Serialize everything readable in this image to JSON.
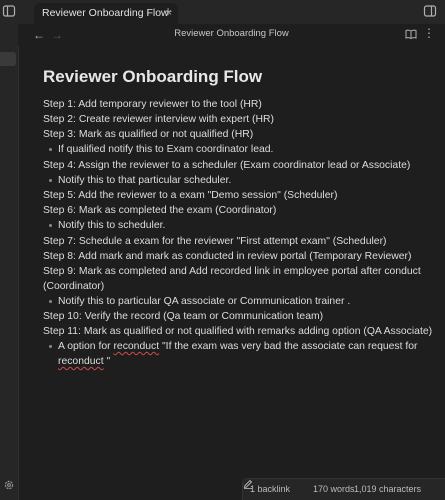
{
  "tabs": [
    {
      "title": "Reviewer Onboarding Flow",
      "close_icon": "×",
      "active": true
    }
  ],
  "new_tab_icon": "+",
  "header": {
    "back_icon": "←",
    "forward_icon": "→",
    "title": "Reviewer Onboarding Flow",
    "more_icon": "⋮"
  },
  "document": {
    "title": "Reviewer Onboarding Flow",
    "l1": "Step 1: Add temporary reviewer to the tool (HR)",
    "l2": "Step 2: Create reviewer interview with expert (HR)",
    "l3": "Step 3: Mark as qualified or not qualified (HR)",
    "b1": "If qualified notify this to Exam coordinator lead.",
    "l4": "Step 4: Assign the reviewer to a scheduler (Exam coordinator lead or Associate)",
    "b2": "Notify this to that particular scheduler.",
    "l5": "Step 5: Add the reviewer to a exam \"Demo session\" (Scheduler)",
    "l6": "Step 6: Mark as completed the exam (Coordinator)",
    "b3": "Notify this to scheduler.",
    "l7": "Step 7: Schedule a exam for the reviewer \"First attempt exam\" (Scheduler)",
    "l8": "Step 8: Add mark and mark as conducted in review portal (Temporary Reviewer)",
    "l9": "Step 9: Mark as completed and Add recorded link in employee portal after conduct (Coordinator)",
    "b4": "Notify this to particular QA associate or Communication trainer .",
    "l10": "Step 10: Verify the record (Qa team or Communication team)",
    "l11": "Step 11: Mark as qualified or not qualified with remarks adding option (QA Associate)",
    "b5_a": "A option for ",
    "b5_b": "reconduct",
    "b5_c": " \"If the exam was very bad the associate can request for ",
    "b5_d": "reconduct",
    "b5_e": " \""
  },
  "status": {
    "backlinks": "1 backlink",
    "words": "170 words",
    "characters": "1,019 characters"
  },
  "colors": {
    "background": "#1e1e1e",
    "chrome": "#262626",
    "text": "#dcddde",
    "spellcheck": "#d04a4a"
  }
}
